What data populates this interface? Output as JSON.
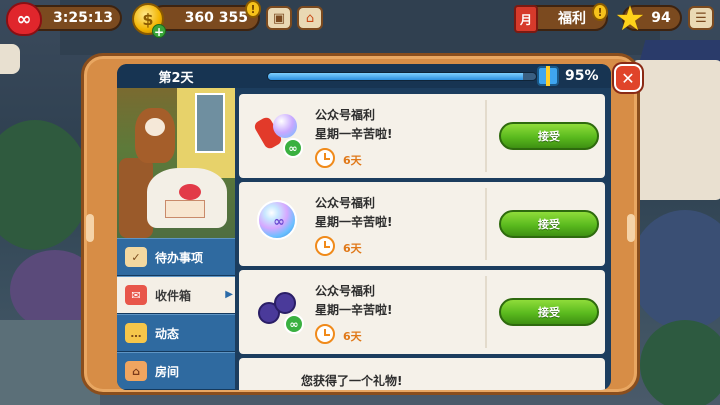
{
  "hud": {
    "lives_timer": "3:25:13",
    "coins": "360 355",
    "gift_label": "福利",
    "stars": "94",
    "alert_mark": "!",
    "calendar_glyph": "月"
  },
  "modal": {
    "day_label": "第2天",
    "progress_percent": "95%",
    "progress_value": 0.95
  },
  "nav": {
    "items": [
      {
        "label": "待办事项",
        "icon": "clipboard-icon"
      },
      {
        "label": "收件箱",
        "icon": "mailbox-icon",
        "active": true
      },
      {
        "label": "动态",
        "icon": "chat-icon"
      },
      {
        "label": "房间",
        "icon": "room-icon"
      }
    ]
  },
  "messages": [
    {
      "title": "公众号福利",
      "body": "星期一辛苦啦!",
      "days": "6天",
      "button": "接受",
      "reward": "rocket-orb-infinite"
    },
    {
      "title": "公众号福利",
      "body": "星期一辛苦啦!",
      "days": "6天",
      "button": "接受",
      "reward": "rainbow-orb-infinite"
    },
    {
      "title": "公众号福利",
      "body": "星期一辛苦啦!",
      "days": "6天",
      "button": "接受",
      "reward": "bombs-infinite"
    },
    {
      "title": "您获得了一个礼物!"
    }
  ],
  "colors": {
    "accept_button": "#5aba1e",
    "progress_fill": "#2b8fe0",
    "modal_frame": "#d78d46",
    "nav_item": "#2f6aa0",
    "close_button": "#e0442a"
  }
}
